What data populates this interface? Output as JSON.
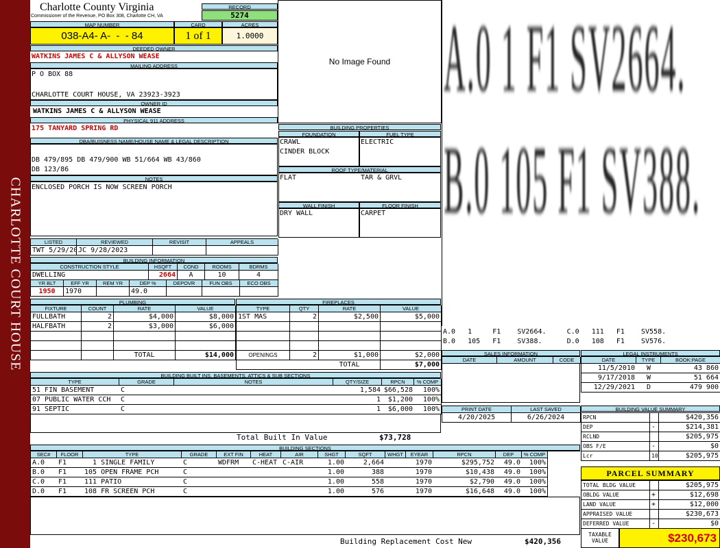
{
  "side_banner": "CHARLOTTE COURT HOUSE",
  "header": {
    "county": "Charlotte County Virginia",
    "commissioner": "Commissioner of the Revenue, PO Box 308, Charlotte CH, VA",
    "record_label": "RECORD",
    "record": "5274",
    "map_label": "MAP NUMBER",
    "map_number": "038-A4- A-  -  - 84",
    "card_label": "CARD",
    "card": "1 of 1",
    "acres_label": "ACRES",
    "acres": "1.0000"
  },
  "owner": {
    "deeded_label": "DEEDED OWNER",
    "deeded": "WATKINS JAMES C & ALLYSON WEASE",
    "mailing_label": "MAILING ADDRESS",
    "mailing_line1": "P O BOX 88",
    "mailing_line2": "CHARLOTTE COURT HOUSE, VA 23923-3923",
    "owner_id_label": "OWNER ID",
    "owner_id": "WATKINS JAMES C & ALLYSON WEASE",
    "phys_label": "PHYSICAL 911 ADDRESS",
    "phys": "175 TANYARD SPRING RD"
  },
  "legal": {
    "label": "DBA/BUISNESS NAME/HOUSE NAME & LEGAL DESCRIPTION",
    "line1": "DB 479/895 DB 479/900 WB 51/664 WB 43/860",
    "line2": "DB 123/86"
  },
  "notes": {
    "label": "NOTES",
    "text": "ENCLOSED PORCH IS NOW SCREEN PORCH"
  },
  "photo": {
    "text": "No Image Found"
  },
  "bldg_props": {
    "label": "BUILDING PROPERTIES",
    "foundation_label": "FOUNDATION",
    "foundation1": "CRAWL",
    "foundation2": "CINDER BLOCK",
    "fuel_label": "FUEL TYPE",
    "fuel": "ELECTRIC",
    "roof_label": "ROOF TYPE/MATERIAL",
    "roof1": "FLAT",
    "roof2": "TAR & GRVL",
    "wall_label": "WALL FINISH",
    "wall": "DRY WALL",
    "floor_label": "FLOOR FINISH",
    "floor": "CARPET"
  },
  "sketch": {
    "big_row1": [
      "A.0  1   F1  SV2664.",
      "C.0  111  F1  SV558."
    ],
    "big_row2": [
      "B.0  105  F1  SV388.",
      "D.0  108  F1  SV576."
    ],
    "legend1": "A.0   1     F1    SV2664.     C.0   111   F1    SV558.",
    "legend2": "B.0   105   F1    SV388.      D.0   108   F1    SV576."
  },
  "listing": {
    "headers": [
      "LISTED",
      "REVIEWED",
      "REVISIT",
      "APPEALS"
    ],
    "listed_by": "TWT",
    "listed_date": "5/29/2018",
    "reviewed_by": "JC",
    "reviewed_date": "9/28/2023"
  },
  "bldg_info": {
    "label": "BUILDING INFORMATION",
    "headers": [
      "CONSTRUCTION STYLE",
      "HSQFT",
      "COND",
      "ROOMS",
      "BDRMS"
    ],
    "style": "DWELLING",
    "hsqft": "2664",
    "cond": "A",
    "rooms": "10",
    "bdrms": "4",
    "headers2": [
      "YR BLT",
      "EFF YR",
      "REM YR",
      "DEP %",
      "DEPOVR",
      "FUN OBS",
      "ECO OBS"
    ],
    "yr_blt": "1950",
    "eff_yr": "1970",
    "rem_yr": "",
    "dep": "49.0"
  },
  "plumbing": {
    "label": "PLUMBING",
    "headers": [
      "FIXTURE",
      "COUNT",
      "RATE",
      "VALUE"
    ],
    "rows": [
      [
        "FULLBATH",
        "2",
        "$4,000",
        "$8,000"
      ],
      [
        "HALFBATH",
        "2",
        "$3,000",
        "$6,000"
      ]
    ],
    "total_label": "TOTAL",
    "total": "$14,000"
  },
  "fireplaces": {
    "label": "FIREPLACES",
    "headers": [
      "TYPE",
      "QTY",
      "RATE",
      "VALUE"
    ],
    "rows": [
      [
        "1ST MAS",
        "2",
        "$2,500",
        "$5,000"
      ]
    ],
    "openings_label": "OPENINGS",
    "openings": [
      "2",
      "$1,000",
      "$2,000"
    ],
    "total_label": "TOTAL",
    "total": "$7,000"
  },
  "builtins": {
    "label": "BUILDING BUILT INS, BASEMENTS, ATTICS & SUB SECTIONS",
    "headers": [
      "TYPE",
      "GRADE",
      "NOTES",
      "QTY/SIZE",
      "RPCN",
      "% COMP"
    ],
    "rows": [
      [
        "51 FIN BASEMENT",
        "C",
        "",
        "1,584",
        "$66,528",
        "100%"
      ],
      [
        "07 PUBLIC WATER CCH",
        "C",
        "",
        "1",
        "$1,200",
        "100%"
      ],
      [
        "91 SEPTIC",
        "C",
        "",
        "1",
        "$6,000",
        "100%"
      ]
    ],
    "total_label": "Total Built In Value",
    "total": "$73,728"
  },
  "sales": {
    "label": "SALES INFORMATION",
    "headers": [
      "DATE",
      "AMOUNT",
      "CODE"
    ]
  },
  "dates": {
    "print_label": "PRINT DATE",
    "print": "4/20/2025",
    "saved_label": "LAST SAVED",
    "saved": "6/26/2024"
  },
  "legal_instr": {
    "label": "LEGAL INSTRUMENTS",
    "headers": [
      "DATE",
      "TYPE",
      "BOOK:PAGE"
    ],
    "rows": [
      [
        "11/5/2010",
        "W",
        "43 860"
      ],
      [
        "9/17/2018",
        "W",
        "51 664"
      ],
      [
        "12/29/2021",
        "D",
        "479 900"
      ]
    ]
  },
  "bvs": {
    "label": "BUILDING VALUE SUMMARY",
    "rows": [
      [
        "RPCN",
        "",
        "$420,356"
      ],
      [
        "DEP",
        "-",
        "$214,381"
      ],
      [
        "RCLND",
        "",
        "$205,975"
      ],
      [
        "OBS F/E",
        "-",
        "$0"
      ],
      [
        "Lcr",
        "100%",
        "$205,975"
      ]
    ]
  },
  "parcel": {
    "label": "PARCEL SUMMARY",
    "rows": [
      [
        "TOTAL BLDG VALUE",
        "",
        "$205,975"
      ],
      [
        "OBLDG VALUE",
        "+",
        "$12,698"
      ],
      [
        "LAND VALUE",
        "+",
        "$12,000"
      ],
      [
        "APPRAISED VALUE",
        "",
        "$230,673"
      ],
      [
        "DEFERRED VALUE",
        "-",
        "$0"
      ]
    ],
    "taxable_label1": "TAXABLE",
    "taxable_label2": "VALUE",
    "taxable": "$230,673"
  },
  "sections": {
    "label": "BUILDING SECTIONS",
    "headers": [
      "SEC#",
      "FLOOR",
      "TYPE",
      "GRADE",
      "EXT FIN",
      "HEAT",
      "AIR",
      "SHGT",
      "SQFT",
      "WHGT",
      "EYEAR",
      "RPCN",
      "DEP",
      "% COMP"
    ],
    "rows": [
      [
        "A.0",
        "F1",
        "  1 SINGLE FAMILY",
        "C",
        "WDFRM",
        "C-HEAT",
        "C-AIR",
        "1.00",
        "2,664",
        "",
        "1970",
        "$295,752",
        "49.0",
        "100%"
      ],
      [
        "B.0",
        "F1",
        "105 OPEN FRAME PCH",
        "C",
        "",
        "",
        "",
        "1.00",
        "388",
        "",
        "1970",
        "$10,438",
        "49.0",
        "100%"
      ],
      [
        "C.0",
        "F1",
        "111 PATIO",
        "C",
        "",
        "",
        "",
        "1.00",
        "558",
        "",
        "1970",
        "$2,790",
        "49.0",
        "100%"
      ],
      [
        "D.0",
        "F1",
        "108 FR SCREEN PCH",
        "C",
        "",
        "",
        "",
        "1.00",
        "576",
        "",
        "1970",
        "$16,648",
        "49.0",
        "100%"
      ]
    ],
    "total_label": "Building Replacement Cost New",
    "total": "$420,356"
  }
}
